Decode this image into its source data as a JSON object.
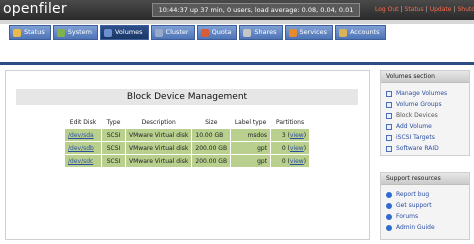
{
  "app": {
    "logo_text": "openfiler",
    "status_text": "10:44:37 up 37 min, 0 users, load average: 0.08, 0.04, 0.01",
    "top_links": [
      "Log Out",
      "Status",
      "Update",
      "Shutdown"
    ]
  },
  "tabs": [
    {
      "label": "Status",
      "icon": "status-icon",
      "color": "#e9b949"
    },
    {
      "label": "System",
      "icon": "system-icon",
      "color": "#7fb24a"
    },
    {
      "label": "Volumes",
      "icon": "volumes-icon",
      "color": "#6b8fcf"
    },
    {
      "label": "Cluster",
      "icon": "cluster-icon",
      "color": "#9aa9c9"
    },
    {
      "label": "Quota",
      "icon": "quota-icon",
      "color": "#d95c3a"
    },
    {
      "label": "Shares",
      "icon": "shares-icon",
      "color": "#c6c6c6"
    },
    {
      "label": "Services",
      "icon": "services-icon",
      "color": "#e68a2e"
    },
    {
      "label": "Accounts",
      "icon": "accounts-icon",
      "color": "#d9b35a"
    }
  ],
  "active_tab_index": 2,
  "main": {
    "heading": "Block Device Management",
    "table": {
      "columns": [
        "Edit Disk",
        "Type",
        "Description",
        "Size",
        "Label type",
        "Partitions"
      ],
      "rows": [
        {
          "edit": "/dev/sda",
          "type": "SCSI",
          "description": "VMware Virtual disk",
          "size": "10.00 GB",
          "label_type": "msdos",
          "partitions_count": "3",
          "view": "view"
        },
        {
          "edit": "/dev/sdb",
          "type": "SCSI",
          "description": "VMware Virtual disk",
          "size": "200.00 GB",
          "label_type": "gpt",
          "partitions_count": "0",
          "view": "view"
        },
        {
          "edit": "/dev/sdc",
          "type": "SCSI",
          "description": "VMware Virtual disk",
          "size": "200.00 GB",
          "label_type": "gpt",
          "partitions_count": "0",
          "view": "view"
        }
      ]
    }
  },
  "sidebar": {
    "volumes_section": {
      "title": "Volumes section",
      "items": [
        {
          "label": "Manage Volumes"
        },
        {
          "label": "Volume Groups"
        },
        {
          "label": "Block Devices"
        },
        {
          "label": "Add Volume"
        },
        {
          "label": "iSCSI Targets"
        },
        {
          "label": "Software RAID"
        }
      ]
    },
    "support_section": {
      "title": "Support resources",
      "items": [
        {
          "label": "Report bug"
        },
        {
          "label": "Get support"
        },
        {
          "label": "Forums"
        },
        {
          "label": "Admin Guide"
        }
      ]
    }
  }
}
